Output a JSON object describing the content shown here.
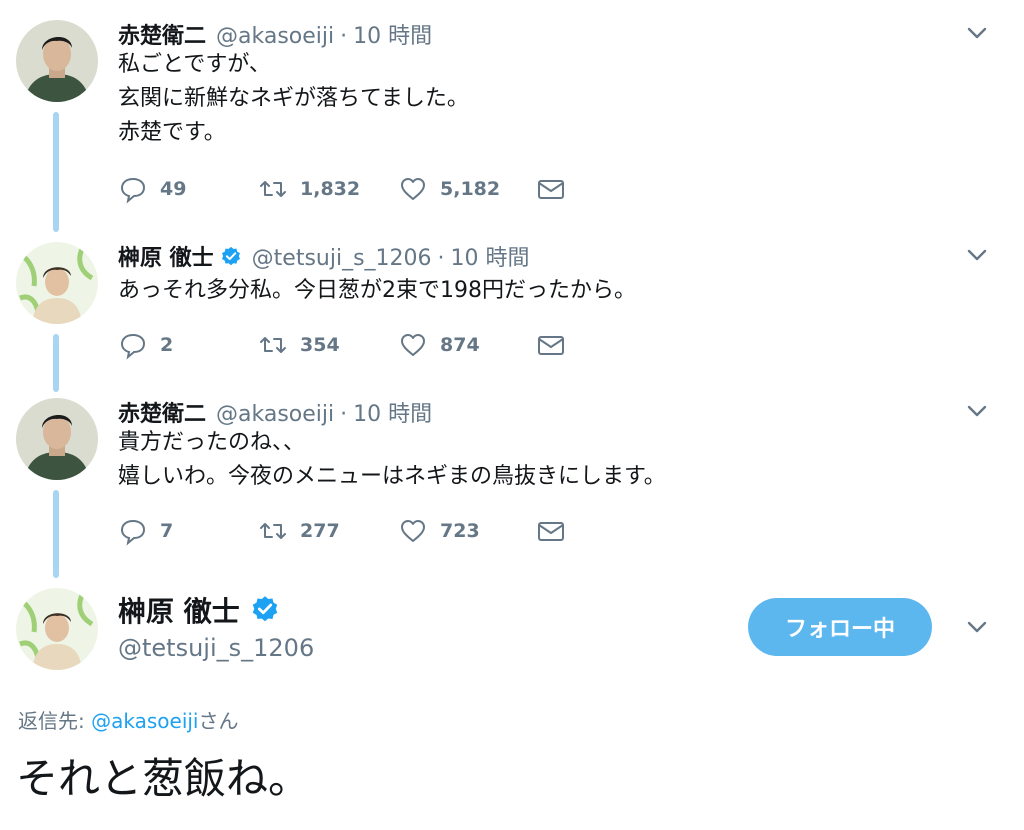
{
  "tweets": [
    {
      "name": "赤楚衛二",
      "handle": "@akasoeiji",
      "dot": "·",
      "time": "10 時間",
      "lines": [
        "私ごとですが、",
        "玄関に新鮮なネギが落ちてました。",
        "赤楚です。"
      ],
      "replies": "49",
      "retweets": "1,832",
      "likes": "5,182"
    },
    {
      "name": "榊原 徹士",
      "handle": "@tetsuji_s_1206",
      "dot": "·",
      "time": "10 時間",
      "lines": [
        "あっそれ多分私。今日葱が2束で198円だったから。"
      ],
      "replies": "2",
      "retweets": "354",
      "likes": "874"
    },
    {
      "name": "赤楚衛二",
      "handle": "@akasoeiji",
      "dot": "·",
      "time": "10 時間",
      "lines": [
        "貴方だったのね、、",
        "嬉しいわ。今夜のメニューはネギまの鳥抜きにします。"
      ],
      "replies": "7",
      "retweets": "277",
      "likes": "723"
    }
  ],
  "focused": {
    "name": "榊原 徹士",
    "handle": "@tetsuji_s_1206",
    "follow_label": "フォロー中",
    "reply_prefix": "返信先: ",
    "reply_mention": "@akasoeiji",
    "reply_suffix": "さん",
    "text": "それと葱飯ね。"
  },
  "colors": {
    "accent": "#1da1f2",
    "follow_button": "#5cb7ef",
    "thread_line": "#a8d5f2",
    "muted": "#657786"
  },
  "icons": [
    "reply-icon",
    "retweet-icon",
    "like-icon",
    "dm-icon",
    "chevron-down-icon",
    "verified-badge-icon"
  ]
}
